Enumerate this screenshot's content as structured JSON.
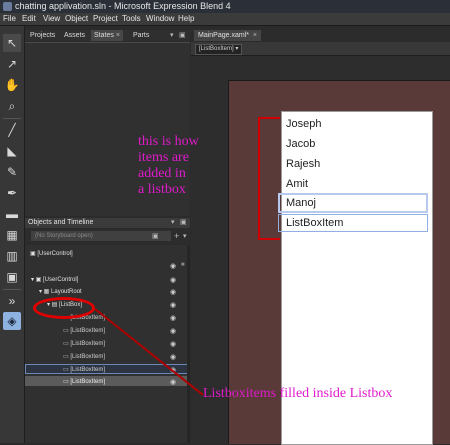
{
  "window": {
    "title": "chatting applivation.sln - Microsoft Expression Blend 4"
  },
  "menu": [
    "File",
    "Edit",
    "View",
    "Object",
    "Project",
    "Tools",
    "Window",
    "Help"
  ],
  "panel_tabs": [
    {
      "label": "Projects"
    },
    {
      "label": "Assets"
    },
    {
      "label": "States"
    },
    {
      "label": "Parts"
    }
  ],
  "document": {
    "tab": "MainPage.xaml*",
    "breadcrumb": "[ListBoxItem]"
  },
  "objects_panel": {
    "header": "Objects and Timeline",
    "storyboard": "(No Storyboard open)",
    "add_button": "+",
    "tree": [
      {
        "label": "[UserControl]"
      },
      {
        "label": "[UserControl]"
      },
      {
        "label": "LayoutRoot"
      },
      {
        "label": "[ListBox]"
      },
      {
        "label": "[ListBoxItem]"
      },
      {
        "label": "[ListBoxItem]"
      },
      {
        "label": "[ListBoxItem]"
      },
      {
        "label": "[ListBoxItem]"
      },
      {
        "label": "[ListBoxItem]"
      },
      {
        "label": "[ListBoxItem]"
      }
    ]
  },
  "listbox_items": [
    "Joseph",
    "Jacob",
    "Rajesh",
    "Amit",
    "Manoj",
    "ListBoxItem"
  ],
  "annotations": {
    "listbox_note": [
      "this is how",
      "items are",
      "added in",
      "a listbox"
    ],
    "tree_note": "Listboxitems filled inside Listbox"
  },
  "colors": {
    "annotation": "#e01acb",
    "highlight": "#e00000",
    "canvas": "#5a3939"
  },
  "tool_icons": [
    "selection-icon",
    "direct-selection-icon",
    "pan-icon",
    "zoom-icon",
    "eyedropper-icon",
    "paint-bucket-icon",
    "brush-icon",
    "pen-icon",
    "rectangle-icon",
    "grid-icon",
    "text-icon",
    "asset-icon",
    "more-icon",
    "assets-panel-icon"
  ]
}
